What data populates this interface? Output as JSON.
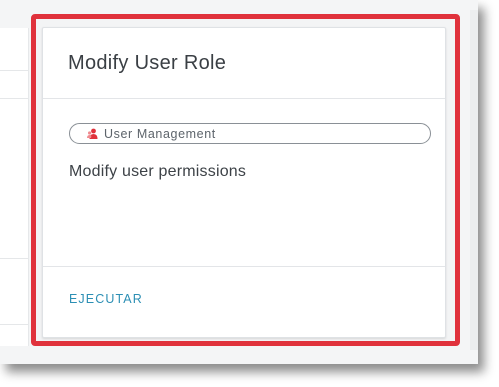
{
  "card": {
    "title": "Modify User Role",
    "category": {
      "label": "User Management",
      "icon": "user-management-icon"
    },
    "description": "Modify user permissions",
    "action_label": "EJECUTAR"
  },
  "colors": {
    "highlight": "#e0323c",
    "action_link": "#2c8fb4",
    "title_text": "#3a3f44",
    "category_icon": "#e0323c"
  }
}
